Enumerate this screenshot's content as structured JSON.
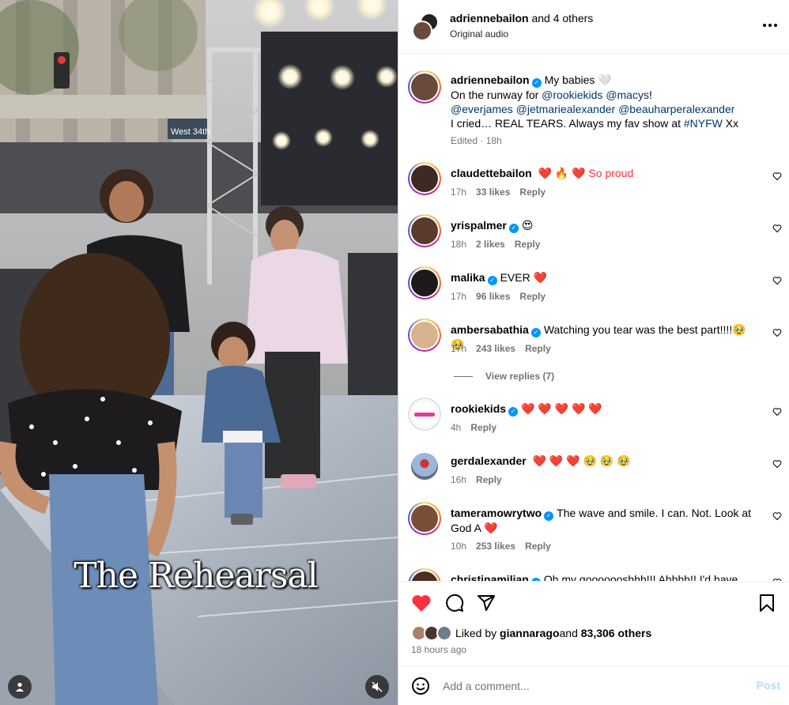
{
  "media": {
    "overlay_text": "The Rehearsal",
    "street_sign": "West 34th",
    "user_icon": "user-icon",
    "mute_icon": "muted-speaker-icon"
  },
  "header": {
    "username": "adriennebailon",
    "others": "and 4 others",
    "audio": "Original audio",
    "more_icon": "more-options-icon"
  },
  "caption": {
    "username": "adriennebailon",
    "line1": "My babies 🤍",
    "line2_prefix": "On the runway for ",
    "mention1": "@rookiekids",
    "mention2": "@macys",
    "line2_suffix": "!",
    "mention3": "@everjames",
    "mention4": "@jetmariealexander",
    "mention5": "@beauharperalexander",
    "line4_prefix": "I cried… REAL TEARS. Always my fav show at ",
    "hashtag": "#NYFW",
    "line4_suffix": " Xx",
    "edited": "Edited",
    "time": "18h"
  },
  "comments": [
    {
      "username": "claudettebailon",
      "verified": false,
      "text": "❤️ 🔥 ❤️  So proud",
      "time": "17h",
      "likes": "33 likes",
      "reply": "Reply"
    },
    {
      "username": "yrispalmer",
      "verified": true,
      "text": "😍",
      "time": "18h",
      "likes": "2 likes",
      "reply": "Reply"
    },
    {
      "username": "malika",
      "verified": true,
      "text": "EVER ❤️",
      "time": "17h",
      "likes": "96 likes",
      "reply": "Reply"
    },
    {
      "username": "ambersabathia",
      "verified": true,
      "text": "Watching you tear was the best part!!!!🥹 🥹",
      "time": "17h",
      "likes": "243 likes",
      "reply": "Reply",
      "view_replies": "View replies (7)"
    },
    {
      "username": "rookiekids",
      "verified": true,
      "text": "❤️ ❤️ ❤️ ❤️ ❤️",
      "time": "4h",
      "likes": "",
      "reply": "Reply"
    },
    {
      "username": "gerdalexander",
      "verified": false,
      "text": "❤️ ❤️ ❤️  🥹 🥹 🥹",
      "time": "16h",
      "likes": "",
      "reply": "Reply"
    },
    {
      "username": "tameramowrytwo",
      "verified": true,
      "text": "The wave and smile. I can. Not. Look at God A ❤️",
      "time": "10h",
      "likes": "253 likes",
      "reply": "Reply"
    },
    {
      "username": "christinamilian",
      "verified": true,
      "text": "Oh my gooooooshhh!!! Ahhhh!! I'd have",
      "time": "",
      "likes": "",
      "reply": ""
    }
  ],
  "actions": {
    "like_icon": "heart-filled-icon",
    "comment_icon": "comment-icon",
    "share_icon": "share-icon",
    "save_icon": "bookmark-icon",
    "liked_by_prefix": "Liked by ",
    "liked_by_user": "giannarago",
    "liked_by_suffix": " and ",
    "liked_by_count": "83,306 others",
    "time_ago": "18 hours ago"
  },
  "add_comment": {
    "placeholder": "Add a comment...",
    "post": "Post",
    "emoji_icon": "emoji-icon"
  },
  "colors": {
    "like_red": "#ff3040",
    "link_blue": "#00376b",
    "verified_blue": "#0095f6",
    "muted": "#737373",
    "post_disabled": "#b2dffc"
  }
}
